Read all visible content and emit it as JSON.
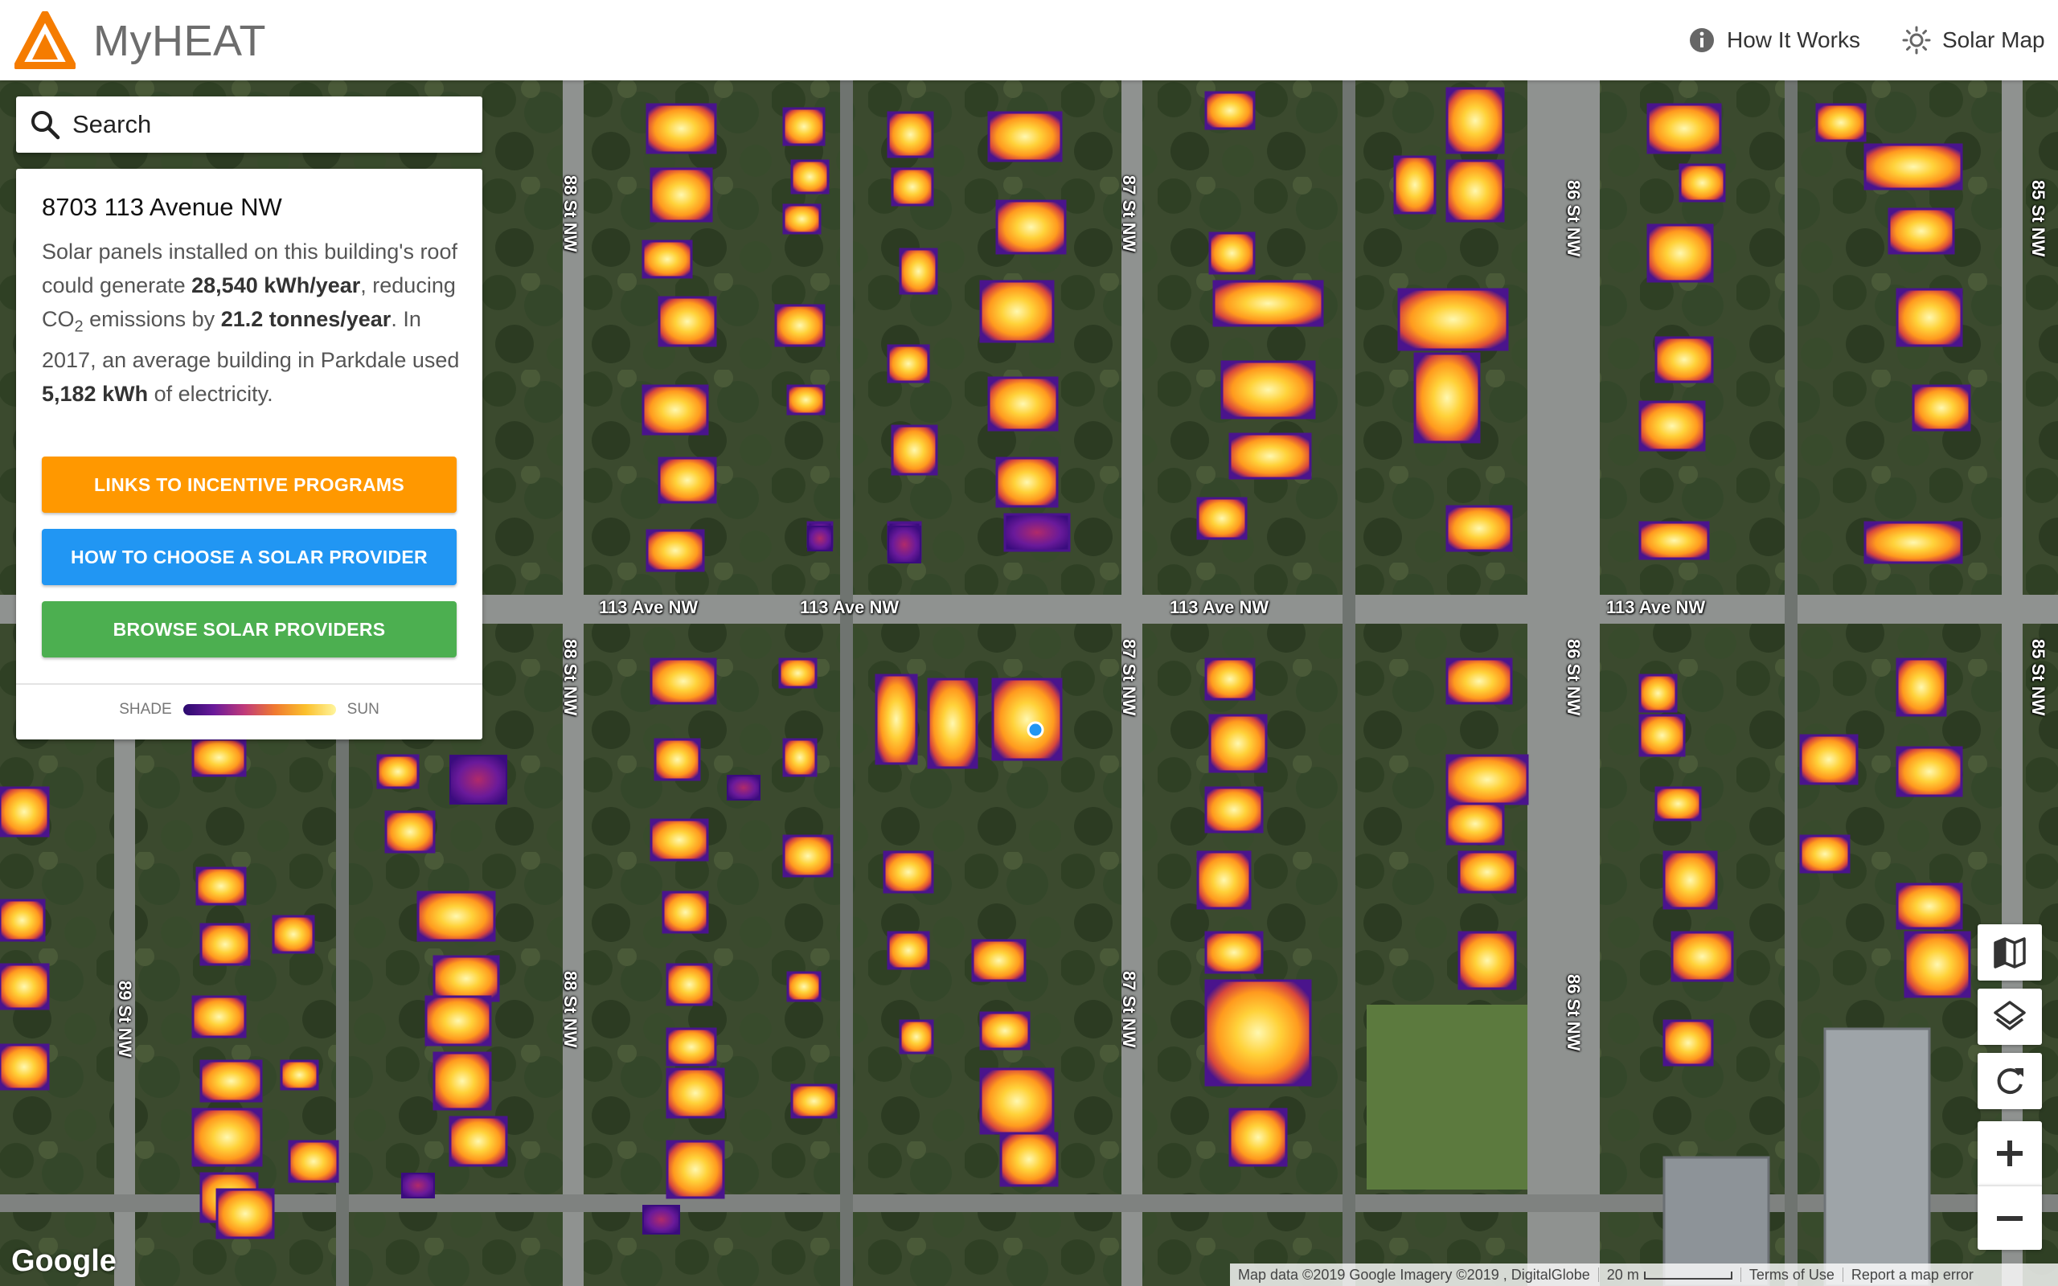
{
  "header": {
    "brand": "MyHEAT",
    "nav": {
      "how_it_works": "How It Works",
      "solar_map": "Solar Map"
    }
  },
  "search": {
    "placeholder": "Search"
  },
  "card": {
    "address": "8703 113 Avenue NW",
    "desc_1": "Solar panels installed on this building's roof could generate ",
    "generation": "28,540 kWh/year",
    "desc_2": ", reducing CO",
    "co2_sub": "2",
    "desc_3": " emissions by ",
    "reduction": "21.2 tonnes/year",
    "desc_4": ". In 2017, an average building in Parkdale used ",
    "average_use": "5,182 kWh",
    "desc_5": " of electricity.",
    "buttons": {
      "incentives": "LINKS TO INCENTIVE PROGRAMS",
      "choose_provider": "HOW TO CHOOSE A SOLAR PROVIDER",
      "browse_providers": "BROWSE SOLAR PROVIDERS"
    },
    "legend": {
      "shade": "SHADE",
      "sun": "SUN"
    }
  },
  "map": {
    "streets": {
      "ave_113": "113 Ave NW",
      "st_85": "85 St NW",
      "st_86": "86 St NW",
      "st_87": "87 St NW",
      "st_88": "88 St NW",
      "st_89": "89 St NW"
    },
    "icons": {
      "map_type": "map-icon",
      "layers": "layers-icon",
      "refresh": "refresh-icon",
      "zoom_in": "plus-icon",
      "zoom_out": "minus-icon"
    },
    "colors": {
      "sun": "#fff59d",
      "shade": "#2a0a6e",
      "marker": "#2196f3"
    }
  },
  "attribution": {
    "google": "Google",
    "map_data": "Map data ©2019 Google Imagery ©2019 , DigitalGlobe",
    "scale": "20 m",
    "terms": "Terms of Use",
    "report": "Report a map error"
  }
}
